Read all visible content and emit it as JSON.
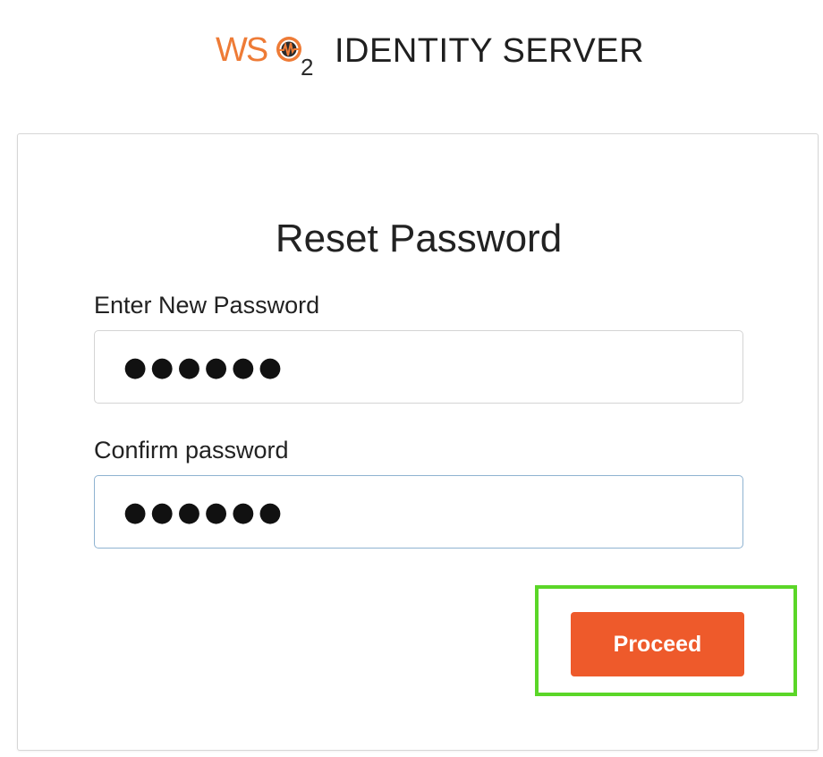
{
  "brand": {
    "logo_icon": "wso2-logo-icon",
    "logo_text": "WSO2",
    "product_name": "IDENTITY SERVER",
    "logo_color": "#ee7b36"
  },
  "form": {
    "title": "Reset Password",
    "new_password_label": "Enter New Password",
    "new_password_value": "●●●●●●",
    "confirm_password_label": "Confirm password",
    "confirm_password_value": "●●●●●●",
    "proceed_label": "Proceed"
  },
  "colors": {
    "accent": "#ee5a2b",
    "highlight": "#5bd628",
    "focus_border": "#8fb3d1"
  }
}
